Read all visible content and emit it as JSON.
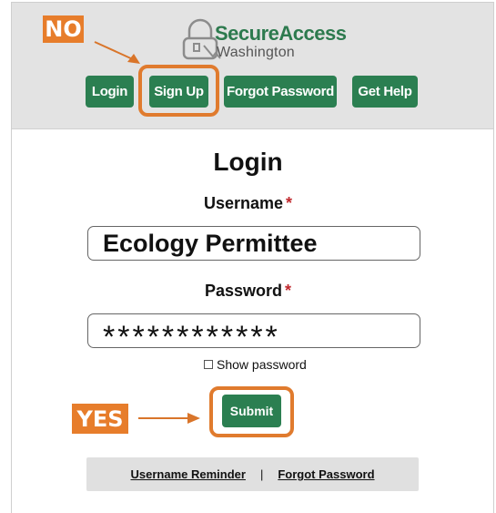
{
  "logo": {
    "title": "SecureAccess",
    "subtitle": "Washington"
  },
  "nav": {
    "login": "Login",
    "signup": "Sign Up",
    "forgot_password": "Forgot Password",
    "get_help": "Get Help"
  },
  "annotations": {
    "no_label": "NO",
    "yes_label": "YES",
    "highlight_color": "#e07b2e"
  },
  "form": {
    "title": "Login",
    "username_label": "Username",
    "username_value": "Ecology Permittee",
    "password_label": "Password",
    "password_value": "************",
    "required_mark": "*",
    "show_password_label": "Show password",
    "submit_label": "Submit"
  },
  "footer": {
    "username_reminder": "Username Reminder",
    "separator": "|",
    "forgot_password": "Forgot Password"
  },
  "colors": {
    "brand_green": "#2b7f51",
    "header_bg": "#e3e3e3",
    "annotation_orange": "#e77d2b",
    "required_red": "#c0282d"
  }
}
